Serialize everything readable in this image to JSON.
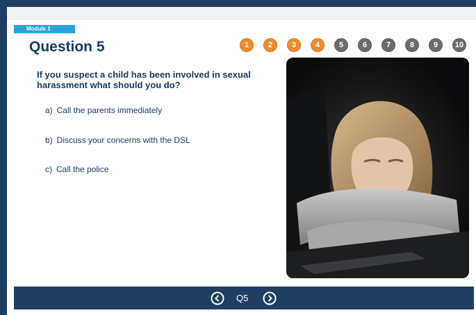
{
  "module_tag": "Module 1",
  "title": "Question 5",
  "question_nav": [
    "1",
    "2",
    "3",
    "4",
    "5",
    "6",
    "7",
    "8",
    "9",
    "10"
  ],
  "answered_count": 4,
  "prompt": "If you suspect a child has been involved in sexual harassment what should you do?",
  "answers": [
    {
      "letter": "a)",
      "text": "Call the parents immediately"
    },
    {
      "letter": "b)",
      "text": "Discuss your concerns with the DSL"
    },
    {
      "letter": "c)",
      "text": "Call the police"
    }
  ],
  "bottom_nav": {
    "current_label": "Q5"
  },
  "colors": {
    "navy": "#1f3e63",
    "accent_orange": "#f08c2c",
    "tag_blue": "#2aa3dd",
    "pending_grey": "#6b6b6b"
  },
  "image": {
    "icon_name": "photo-girl-at-laptop"
  }
}
